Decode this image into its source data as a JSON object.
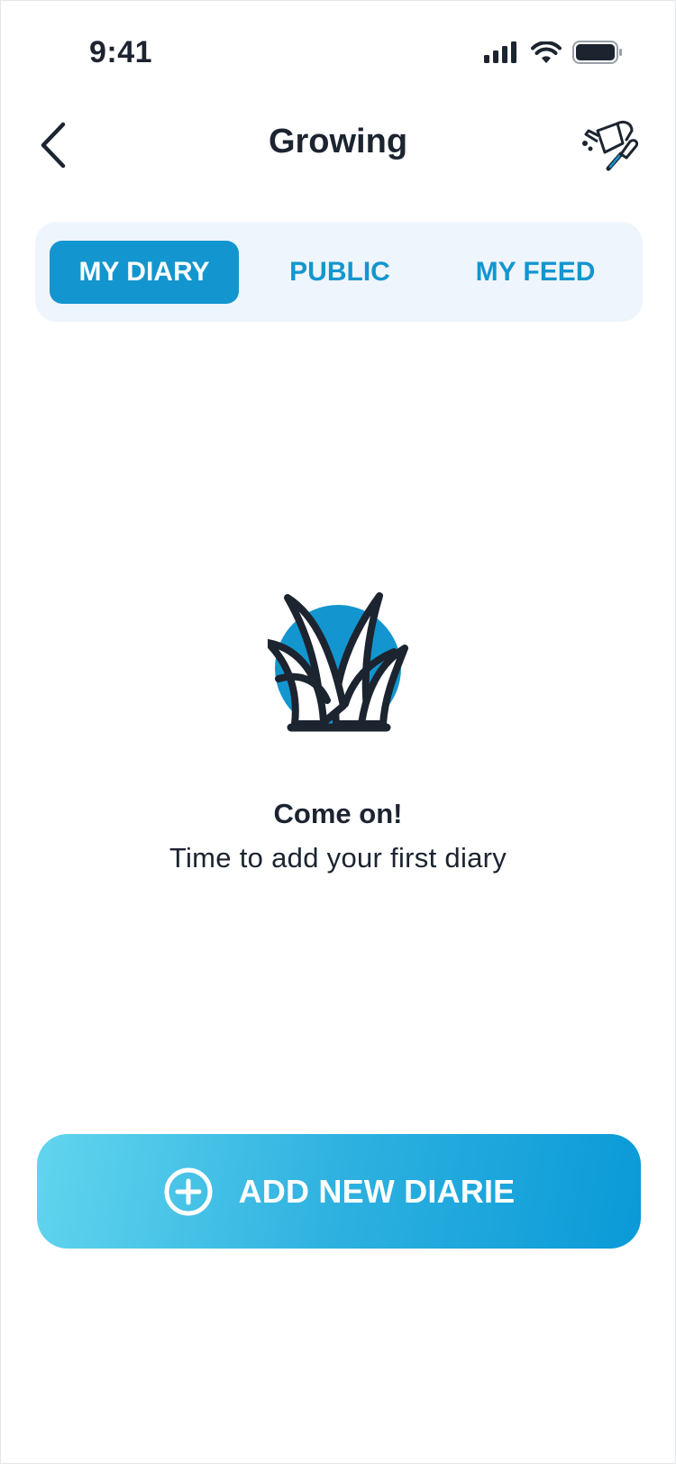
{
  "status_bar": {
    "time": "9:41"
  },
  "header": {
    "title": "Growing",
    "back_icon": "chevron-left-icon",
    "action_icon": "watering-can-icon"
  },
  "tabs": [
    {
      "label": "MY DIARY",
      "active": true
    },
    {
      "label": "PUBLIC",
      "active": false
    },
    {
      "label": "MY FEED",
      "active": false
    }
  ],
  "empty_state": {
    "icon": "plant-icon",
    "title": "Come on!",
    "subtitle": "Time to add your first diary"
  },
  "cta": {
    "label": "ADD NEW DIARIE",
    "icon": "plus-circle-icon"
  },
  "colors": {
    "accent": "#1396CF",
    "tab_bg": "#EFF5FC",
    "text": "#1C2430",
    "cta_gradient_start": "#62D5EE",
    "cta_gradient_end": "#0A9AD7"
  }
}
